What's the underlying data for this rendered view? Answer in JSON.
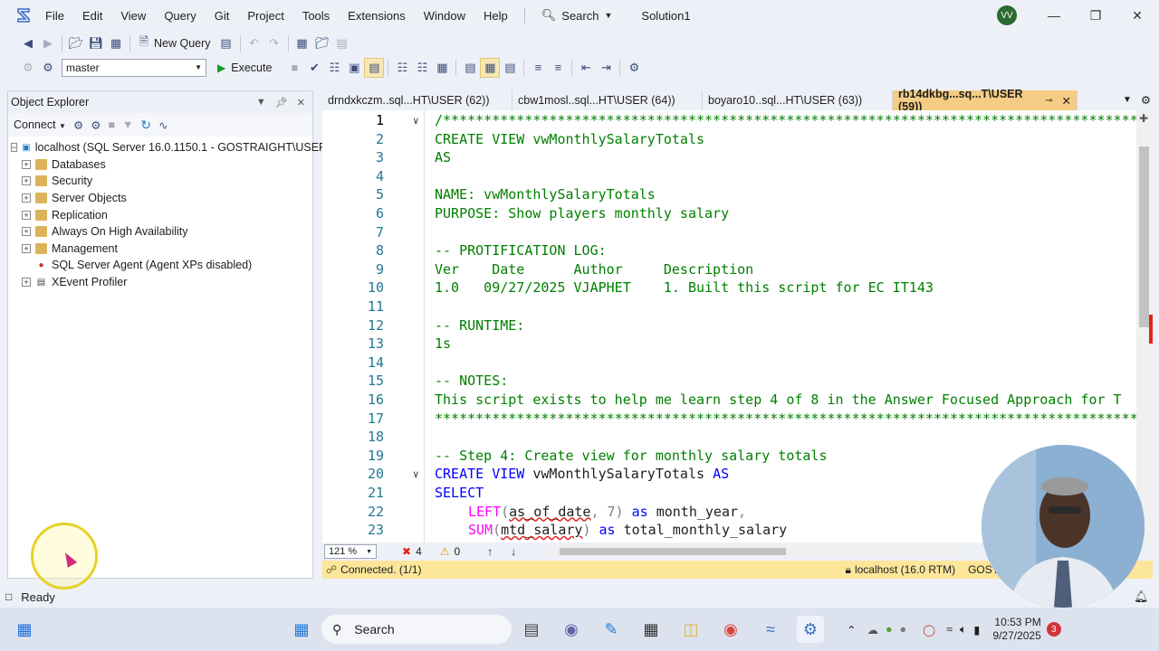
{
  "menu": {
    "items": [
      "File",
      "Edit",
      "View",
      "Query",
      "Git",
      "Project",
      "Tools",
      "Extensions",
      "Window",
      "Help"
    ],
    "search_label": "Search",
    "solution": "Solution1",
    "avatar": "VV"
  },
  "toolbar": {
    "new_query": "New Query",
    "database": "master",
    "execute": "Execute"
  },
  "object_explorer": {
    "title": "Object Explorer",
    "connect": "Connect",
    "root": "localhost (SQL Server 16.0.1150.1 - GOSTRAIGHT\\USER)",
    "nodes": [
      "Databases",
      "Security",
      "Server Objects",
      "Replication",
      "Always On High Availability",
      "Management",
      "SQL Server Agent (Agent XPs disabled)",
      "XEvent Profiler"
    ]
  },
  "tabs": [
    {
      "label": "drndxkczm..sql...HT\\USER (62))"
    },
    {
      "label": "cbw1mosl..sql...HT\\USER (64))"
    },
    {
      "label": "boyaro10..sql...HT\\USER (63))"
    },
    {
      "label": "rb14dkbg...sq...T\\USER (59))"
    }
  ],
  "editor": {
    "line_numbers": [
      "1",
      "2",
      "3",
      "4",
      "5",
      "6",
      "7",
      "8",
      "9",
      "10",
      "11",
      "12",
      "13",
      "14",
      "15",
      "16",
      "17",
      "18",
      "19",
      "20",
      "21",
      "22",
      "23"
    ],
    "comment_stars": "/*********************************************************************************************************",
    "stars_end": "**********************************************************************************************************",
    "l2": "CREATE VIEW vwMonthlySalaryTotals",
    "l3": "AS",
    "l5": "NAME: vwMonthlySalaryTotals",
    "l6": "PURPOSE: Show players monthly salary",
    "l8": "-- PROTIFICATION LOG:",
    "l9": "Ver    Date      Author     Description",
    "l10": "1.0   09/27/2025 VJAPHET    1. Built this script for EC IT143",
    "l12": "-- RUNTIME:",
    "l13": "1s",
    "l15": "-- NOTES:",
    "l16": "This script exists to help me learn step 4 of 8 in the Answer Focused Approach for T",
    "l19": "-- Step 4: Create view for monthly salary totals",
    "l20_kw1": "CREATE VIEW",
    "l20_name": " vwMonthlySalaryTotals ",
    "l20_kw2": "AS",
    "l21": "SELECT",
    "l22_fn": "LEFT",
    "l22_arg": "as_of_date",
    "l22_rest": ", 7)",
    "l22_as": " as ",
    "l22_alias": "month_year",
    "l22_comma": ",",
    "l23_fn": "SUM",
    "l23_arg": "mtd_salary",
    "l23_as": " as ",
    "l23_alias": "total_monthly_salary"
  },
  "editor_status": {
    "zoom": "121 %",
    "errors": "4",
    "warnings": "0"
  },
  "connection_bar": {
    "status": "Connected. (1/1)",
    "server": "localhost (16.0 RTM)",
    "user": "GOSTRAIGHT\\USER (59)"
  },
  "status": {
    "ready": "Ready"
  },
  "taskbar": {
    "search": "Search",
    "time": "10:53 PM",
    "date": "9/27/2025",
    "badge": "3"
  }
}
